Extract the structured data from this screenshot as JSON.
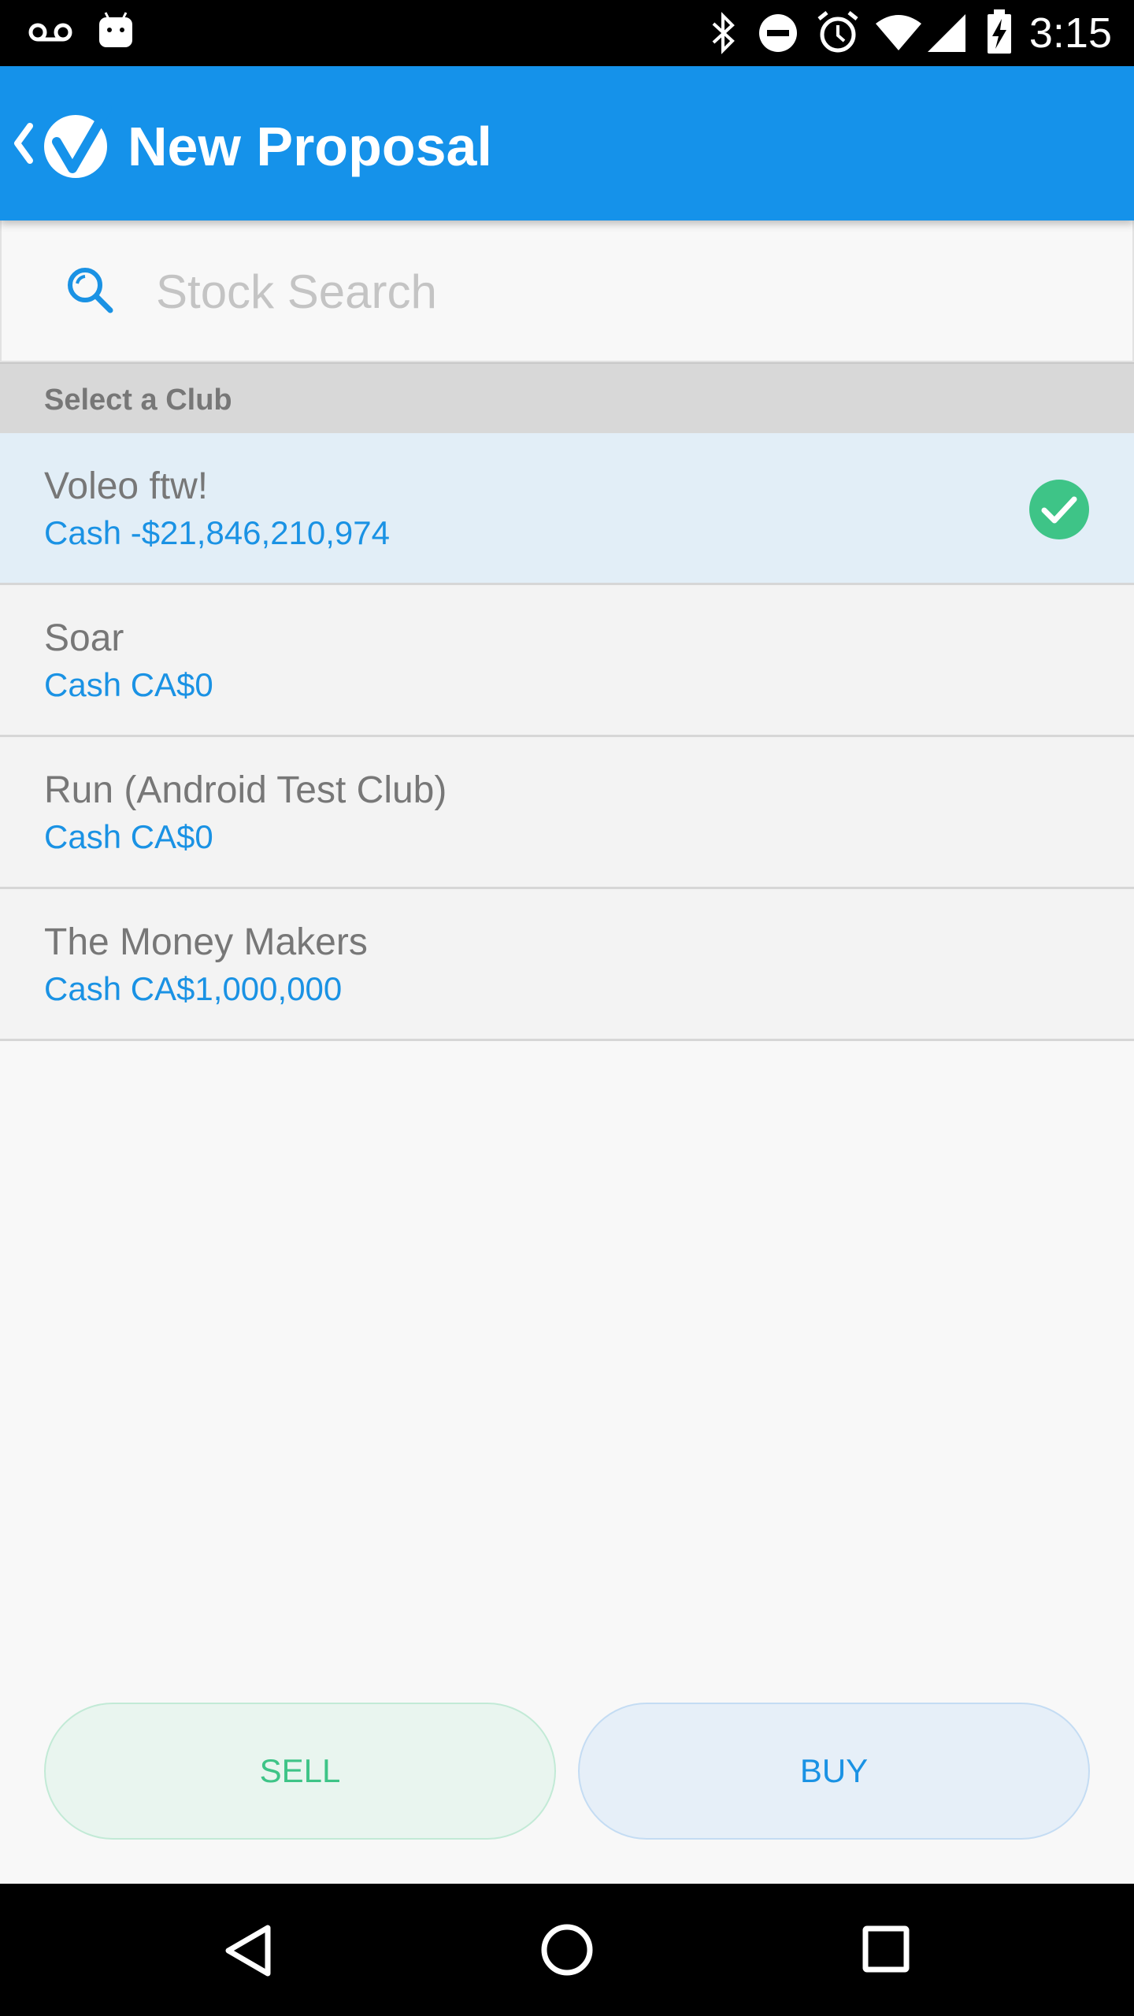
{
  "status_bar": {
    "time": "3:15",
    "icons": [
      "voicemail-icon",
      "android-icon",
      "bluetooth-icon",
      "do-not-disturb-icon",
      "alarm-icon",
      "wifi-icon",
      "signal-icon",
      "battery-charging-icon"
    ]
  },
  "app_bar": {
    "title": "New Proposal",
    "back_icon": "chevron-left-icon",
    "logo_icon": "voleo-logo-icon",
    "color": "#1592ea"
  },
  "search": {
    "placeholder": "Stock Search",
    "value": "",
    "icon": "search-icon"
  },
  "club_section": {
    "header": "Select a Club",
    "clubs": [
      {
        "name": "Voleo ftw!",
        "cash": "Cash -$21,846,210,974",
        "selected": true
      },
      {
        "name": "Soar",
        "cash": "Cash CA$0",
        "selected": false
      },
      {
        "name": "Run (Android Test Club)",
        "cash": "Cash CA$0",
        "selected": false
      },
      {
        "name": "The Money Makers",
        "cash": "Cash CA$1,000,000",
        "selected": false
      }
    ],
    "selected_icon": "check-circle-icon",
    "selected_color": "#3ec487"
  },
  "actions": {
    "sell_label": "SELL",
    "buy_label": "BUY",
    "sell_color": "#3ec487",
    "buy_color": "#1a92e4"
  },
  "nav_bar": {
    "icons": [
      "back-triangle-icon",
      "home-circle-icon",
      "recents-square-icon"
    ]
  }
}
